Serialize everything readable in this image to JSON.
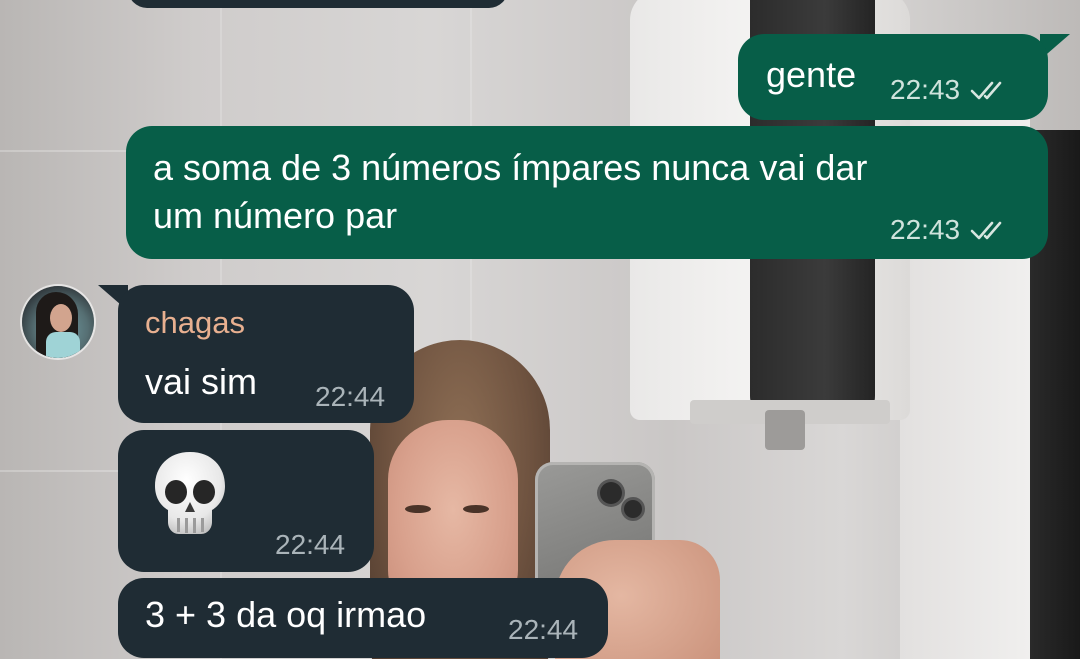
{
  "messages": [
    {
      "direction": "outgoing",
      "text": "gente",
      "time": "22:43",
      "status": "read"
    },
    {
      "direction": "outgoing",
      "text_lines": [
        "a soma de 3 números ímpares nunca vai dar",
        "um número par"
      ],
      "time": "22:43",
      "status": "read"
    },
    {
      "direction": "incoming",
      "sender": "chagas",
      "text": "vai sim",
      "time": "22:44"
    },
    {
      "direction": "incoming",
      "emoji": "skull-icon",
      "time": "22:44"
    },
    {
      "direction": "incoming",
      "text": "3 + 3 da oq irmao",
      "time": "22:44"
    }
  ],
  "colors": {
    "outgoing_bubble": "#075e48",
    "incoming_bubble": "#1f2c34",
    "sender_name": "#e8b090",
    "read_ticks": "#d7e6e0"
  }
}
